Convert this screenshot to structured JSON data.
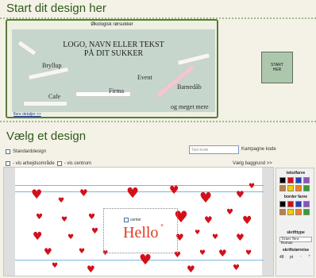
{
  "headings": {
    "start": "Start dit design her",
    "design": "Vælg et design"
  },
  "promo": {
    "heading": "Økologisk rørsukker",
    "headline_1": "LOGO, NAVN ELLER TEKST",
    "headline_2": "PÅ DIT SUKKER",
    "labels": [
      "Bryllup",
      "Event",
      "Barnedåb",
      "Cafe",
      "Firma",
      "og meget mere"
    ],
    "link": "flere detaljer >>"
  },
  "start_button": {
    "line_1": "START",
    "line_2": "HER"
  },
  "controls": {
    "standard_design": "Standarddesign",
    "code_placeholder": "Tast kode",
    "code_label": "Kampagne kode",
    "view_work_area": "- vis arbejdsområde",
    "view_center": "- vis centrum",
    "choose_background": "Vælg baggrund >>"
  },
  "canvas": {
    "text": "Hello",
    "center_label": "center",
    "close": "×"
  },
  "panel": {
    "text_color": "tekstfarve",
    "border_color": "border farve",
    "font_type": "skrifttype",
    "font_value": "Times New Roman",
    "font_size": "skriftstørrelse",
    "size_value": "48",
    "size_unit": "pt",
    "minus": "-",
    "plus": "+",
    "text_swatches": [
      "#000000",
      "#d01010",
      "#2040c0",
      "#9050c0",
      "#c08040",
      "#f0d000",
      "#f08020",
      "#30a030"
    ],
    "border_swatches": [
      "#000000",
      "#d01010",
      "#2040c0",
      "#9050c0",
      "#c08040",
      "#f0d000",
      "#f08020",
      "#30a030"
    ]
  },
  "colors": {
    "accent_green": "#2f5a1c",
    "heart_red": "#d3101a",
    "text_red": "#e53a22"
  }
}
